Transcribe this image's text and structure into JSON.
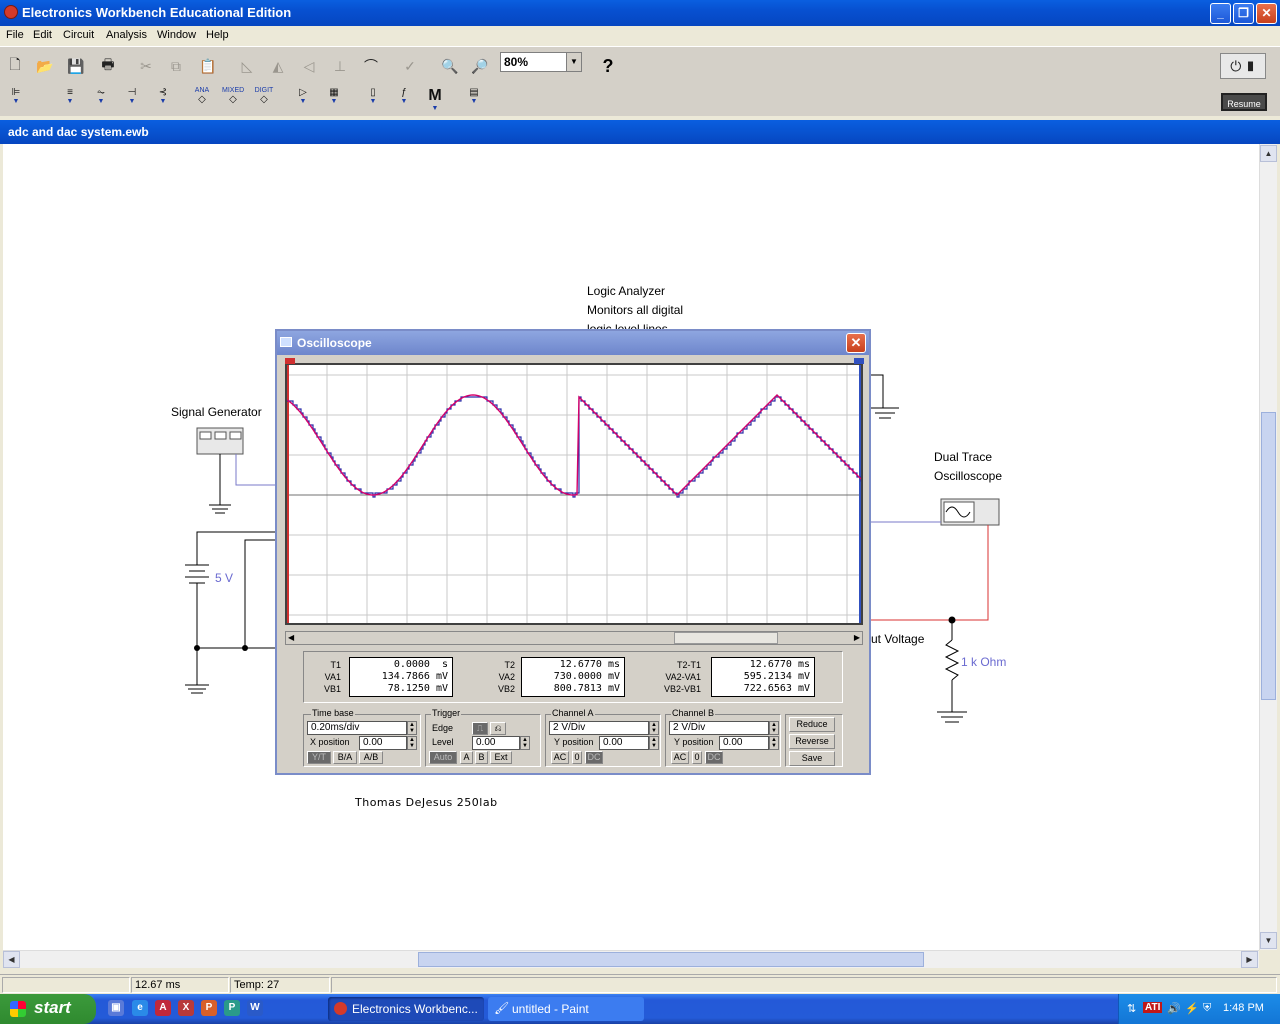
{
  "app": {
    "title": "Electronics Workbench Educational Edition"
  },
  "window_buttons": {
    "minimize": "_",
    "maximize": "❐",
    "close": "✕"
  },
  "menu": [
    "File",
    "Edit",
    "Circuit",
    "Analysis",
    "Window",
    "Help"
  ],
  "toolbar": {
    "zoom": "80%",
    "help": "?",
    "resume": "Resume"
  },
  "toolbar2": {
    "analog_label": "ANA",
    "mixed_label": "MIXED",
    "digital_label": "DIGIT",
    "misc_label": "M"
  },
  "document": {
    "title": "adc and dac system.ewb"
  },
  "circuit": {
    "logic_analyzer_lines": [
      "Logic Analyzer",
      "Monitors all digital",
      "logic level lines"
    ],
    "signal_generator": "Signal Generator",
    "battery": "5 V",
    "dual_trace_lines": [
      "Dual Trace",
      "Oscilloscope"
    ],
    "output_voltage": "ut Voltage",
    "resistor": "1 k Ohm",
    "author": "Thomas DeJesus 250lab"
  },
  "oscilloscope": {
    "title": "Oscilloscope",
    "readouts": {
      "t1": {
        "labels": [
          "T1",
          "VA1",
          "VB1"
        ],
        "values": [
          "0.0000  s",
          "134.7866 mV",
          "78.1250 mV"
        ]
      },
      "t2": {
        "labels": [
          "T2",
          "VA2",
          "VB2"
        ],
        "values": [
          "12.6770 ms",
          "730.0000 mV",
          "800.7813 mV"
        ]
      },
      "diff": {
        "labels": [
          "T2-T1",
          "VA2-VA1",
          "VB2-VB1"
        ],
        "values": [
          "12.6770 ms",
          "595.2134 mV",
          "722.6563 mV"
        ]
      }
    },
    "timebase": {
      "label": "Time base",
      "value": "0.20ms/div",
      "xpos_label": "X position",
      "xpos": "0.00",
      "modes": [
        "Y/T",
        "B/A",
        "A/B"
      ]
    },
    "trigger": {
      "label": "Trigger",
      "edge_label": "Edge",
      "level_label": "Level",
      "level": "0.00",
      "sources": [
        "Auto",
        "A",
        "B",
        "Ext"
      ]
    },
    "channel_a": {
      "label": "Channel A",
      "scale": "2 V/Div",
      "ypos_label": "Y position",
      "ypos": "0.00",
      "coupling": [
        "AC",
        "0",
        "DC"
      ]
    },
    "channel_b": {
      "label": "Channel B",
      "scale": "2 V/Div",
      "ypos_label": "Y position",
      "ypos": "0.00",
      "coupling": [
        "AC",
        "0",
        "DC"
      ]
    },
    "buttons": {
      "reduce": "Reduce",
      "reverse": "Reverse",
      "save": "Save"
    },
    "trace_colors": {
      "a": "#d4006a",
      "b": "#2a2aa8"
    }
  },
  "status": {
    "time": "12.67 ms",
    "temp": "Temp: 27"
  },
  "taskbar": {
    "start": "start",
    "tasks": [
      "Electronics Workbenc...",
      "untitled - Paint"
    ],
    "clock": "1:48 PM",
    "tray_ati": "ATI"
  }
}
